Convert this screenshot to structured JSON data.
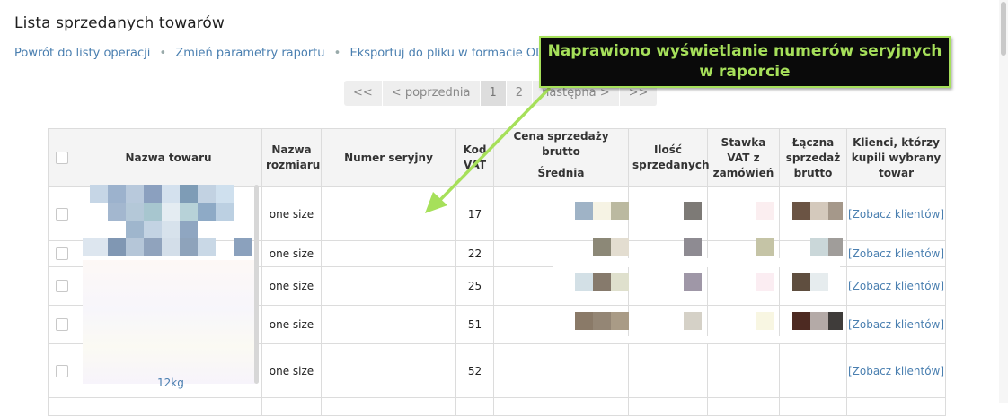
{
  "page": {
    "title": "Lista sprzedanych towarów",
    "links": [
      "Powrót do listy operacji",
      "Zmień parametry raportu",
      "Eksportuj do pliku w formacie ODS"
    ],
    "link_separator": "•"
  },
  "pagination": {
    "first": "<<",
    "prev": "< poprzednia",
    "pages": [
      "1",
      "2"
    ],
    "current_page": "1",
    "next": "następna >",
    "last": ">>"
  },
  "table": {
    "headers": {
      "name": "Nazwa towaru",
      "size": "Nazwa rozmiaru",
      "serial": "Numer seryjny",
      "code": "Kod VAT",
      "gross_price": "Cena sprzedaży brutto",
      "gross_price_avg": "Średnia",
      "qty": "Ilość sprzedanych",
      "vat_rate": "Stawka VAT z zamówień",
      "total_gross": "Łączna sprzedaż brutto",
      "clients": "Klienci, którzy kupili wybrany towar"
    },
    "rows": [
      {
        "size": "one size",
        "serial": "",
        "code": "17",
        "clients_link": "[Zobacz klientów]"
      },
      {
        "size": "one size",
        "serial": "",
        "code": "22",
        "clients_link": "[Zobacz klientów]"
      },
      {
        "size": "one size",
        "serial": "",
        "code": "25",
        "clients_link": "[Zobacz klientów]"
      },
      {
        "size": "one size",
        "serial": "",
        "code": "51",
        "clients_link": "[Zobacz klientów]"
      },
      {
        "size": "one size",
        "serial": "",
        "code": "52",
        "clients_link": "[Zobacz klientów]"
      }
    ],
    "partial_text": "12kg"
  },
  "annotation": {
    "text": "Naprawiono wyświetlanie numerów seryjnych w raporcie",
    "colors": {
      "fill": "#0a0a0a",
      "text": "#a6e05a",
      "arrow": "#a6e05a"
    }
  },
  "colors": {
    "link": "#4a7fb0",
    "header_bg": "#f4f4f4",
    "border": "#dcdcdc"
  }
}
